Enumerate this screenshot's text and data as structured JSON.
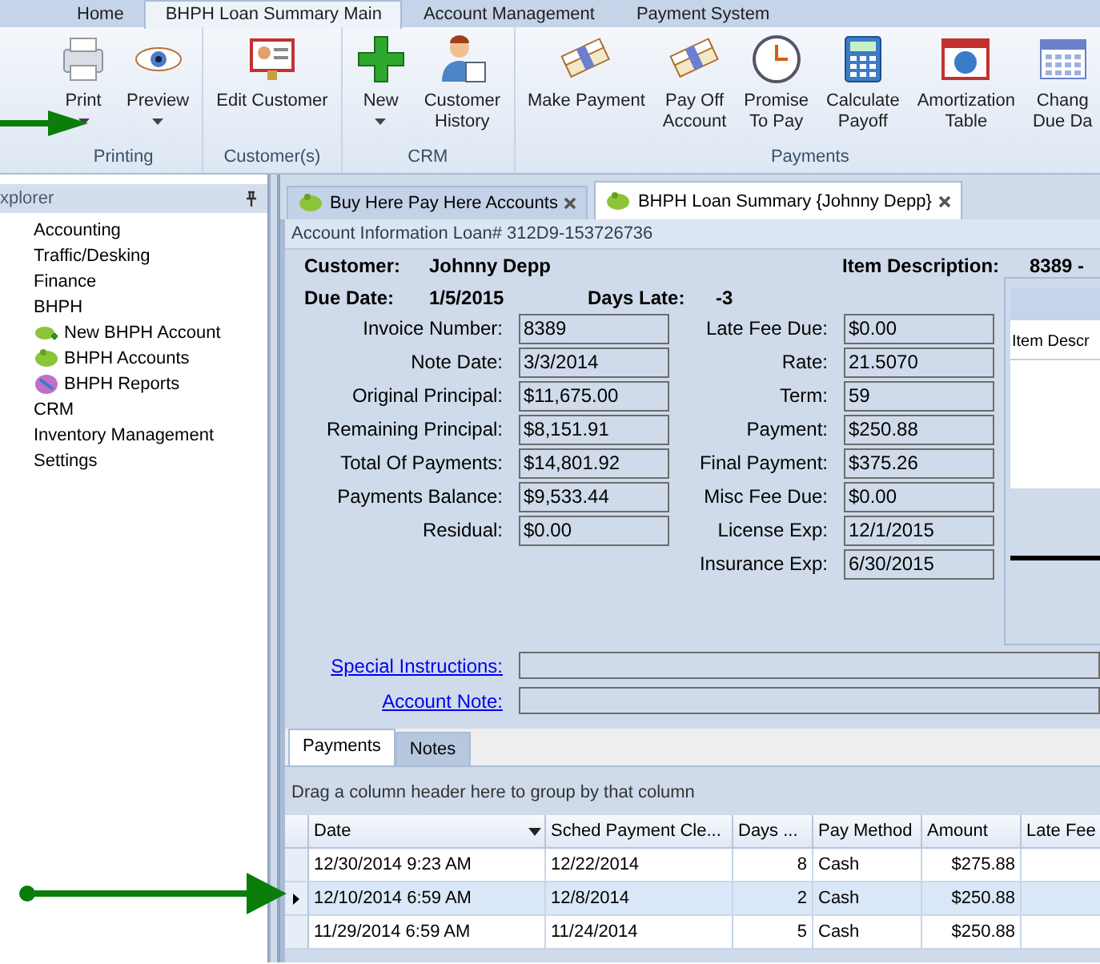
{
  "ribbon_tabs": [
    {
      "label": "Home",
      "selected": false
    },
    {
      "label": "BHPH Loan Summary Main",
      "selected": true
    },
    {
      "label": "Account Management",
      "selected": false
    },
    {
      "label": "Payment System",
      "selected": false
    }
  ],
  "ribbon_groups": [
    {
      "title": "Printing",
      "buttons": [
        {
          "kind": "printer",
          "label": "Print",
          "dropdown": true
        },
        {
          "kind": "eye",
          "label": "Preview",
          "dropdown": true
        }
      ]
    },
    {
      "title": "Customer(s)",
      "buttons": [
        {
          "kind": "card",
          "label": "Edit Customer",
          "dropdown": false
        }
      ]
    },
    {
      "title": "CRM",
      "buttons": [
        {
          "kind": "plus",
          "label": "New",
          "dropdown": true
        },
        {
          "kind": "person",
          "label": "Customer\nHistory",
          "dropdown": false
        }
      ]
    },
    {
      "title": "Payments",
      "buttons": [
        {
          "kind": "cash",
          "label": "Make Payment",
          "dropdown": false
        },
        {
          "kind": "cash",
          "label": "Pay Off\nAccount",
          "dropdown": false
        },
        {
          "kind": "clock",
          "label": "Promise\nTo Pay",
          "dropdown": false
        },
        {
          "kind": "calculator",
          "label": "Calculate\nPayoff",
          "dropdown": false
        },
        {
          "kind": "chart",
          "label": "Amortization\nTable",
          "dropdown": false
        },
        {
          "kind": "calendar",
          "label": "Chang\nDue Da",
          "dropdown": false
        }
      ]
    }
  ],
  "explorer": {
    "title": "xplorer",
    "items": [
      {
        "label": "Accounting"
      },
      {
        "label": "Traffic/Desking"
      },
      {
        "label": "Finance"
      },
      {
        "label": "BHPH",
        "children": [
          {
            "label": "New BHPH Account",
            "kind": "piggy-add"
          },
          {
            "label": "BHPH Accounts",
            "kind": "piggy"
          },
          {
            "label": "BHPH Reports",
            "kind": "report"
          }
        ]
      },
      {
        "label": "CRM"
      },
      {
        "label": "Inventory Management"
      },
      {
        "label": "Settings"
      }
    ]
  },
  "doc_tabs": [
    {
      "label": "Buy Here Pay Here Accounts",
      "selected": false
    },
    {
      "label": "BHPH Loan Summary {Johnny Depp}",
      "selected": true
    }
  ],
  "account": {
    "header": "Account Information Loan# 312D9-153726736",
    "customer_label": "Customer:",
    "customer": "Johnny Depp",
    "item_label": "Item Description:",
    "item": "8389 -",
    "due_label": "Due Date:",
    "due": "1/5/2015",
    "late_label": "Days Late:",
    "late": "-3",
    "left_fields": [
      {
        "label": "Invoice Number:",
        "value": "8389"
      },
      {
        "label": "Note Date:",
        "value": "3/3/2014"
      },
      {
        "label": "Original Principal:",
        "value": "$11,675.00"
      },
      {
        "label": "Remaining Principal:",
        "value": "$8,151.91"
      },
      {
        "label": "Total Of Payments:",
        "value": "$14,801.92"
      },
      {
        "label": "Payments Balance:",
        "value": "$9,533.44"
      },
      {
        "label": "Residual:",
        "value": "$0.00"
      }
    ],
    "right_fields": [
      {
        "label": "Late Fee Due:",
        "value": "$0.00"
      },
      {
        "label": "Rate:",
        "value": "21.5070"
      },
      {
        "label": "Term:",
        "value": "59"
      },
      {
        "label": "Payment:",
        "value": "$250.88"
      },
      {
        "label": "Final Payment:",
        "value": "$375.26"
      },
      {
        "label": "Misc Fee Due:",
        "value": "$0.00"
      },
      {
        "label": "License Exp:",
        "value": "12/1/2015"
      },
      {
        "label": "Insurance Exp:",
        "value": "6/30/2015"
      }
    ],
    "item_column": "Item Descr",
    "links": [
      "Special Instructions:",
      "Account Note:"
    ]
  },
  "bottom_tabs": [
    {
      "label": "Payments",
      "selected": true
    },
    {
      "label": "Notes",
      "selected": false
    }
  ],
  "grid": {
    "group_hint": "Drag a column header here to group by that column",
    "columns": [
      "Date",
      "Sched Payment Cle...",
      "Days ...",
      "Pay Method",
      "Amount",
      "Late Fee"
    ],
    "rows": [
      {
        "selected": false,
        "cells": [
          "12/30/2014 9:23 AM",
          "12/22/2014",
          "8",
          "Cash",
          "$275.88"
        ]
      },
      {
        "selected": true,
        "cells": [
          "12/10/2014 6:59 AM",
          "12/8/2014",
          "2",
          "Cash",
          "$250.88"
        ]
      },
      {
        "selected": false,
        "cells": [
          "11/29/2014 6:59 AM",
          "11/24/2014",
          "5",
          "Cash",
          "$250.88"
        ]
      }
    ]
  }
}
